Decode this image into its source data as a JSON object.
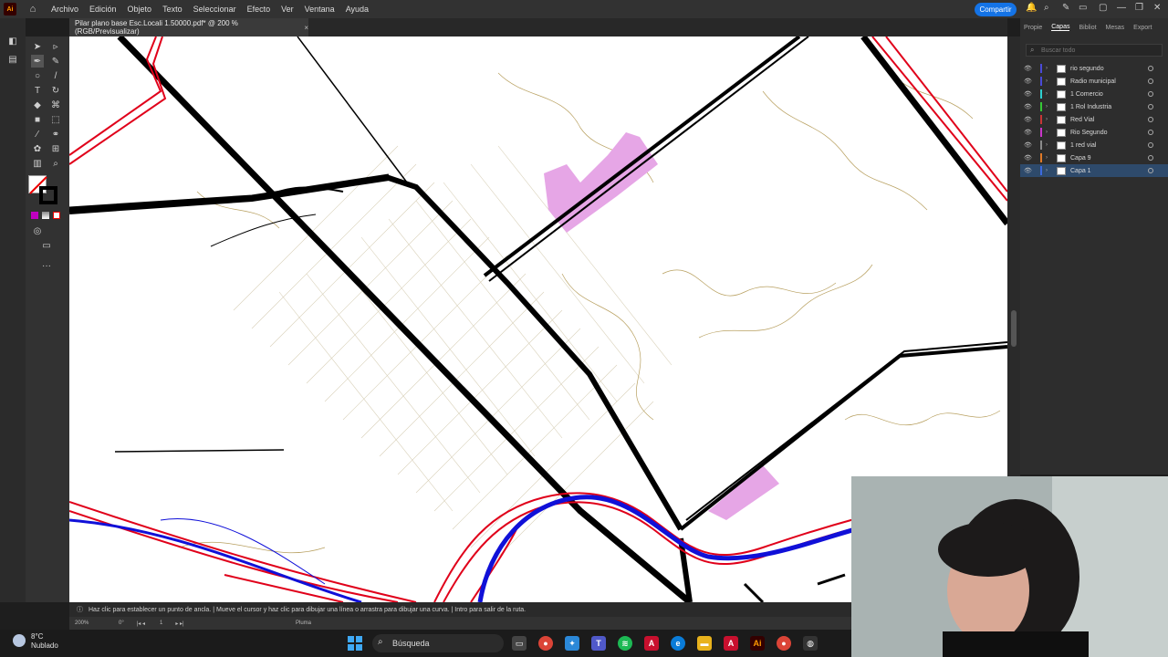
{
  "menubar": {
    "items": [
      "Archivo",
      "Edición",
      "Objeto",
      "Texto",
      "Seleccionar",
      "Efecto",
      "Ver",
      "Ventana",
      "Ayuda"
    ],
    "share_label": "Compartir"
  },
  "document": {
    "tab_title": "Pilar plano base Esc.Locali 1.50000.pdf* @ 200 % (RGB/Previsualizar)"
  },
  "panel": {
    "tabs": [
      "Propie",
      "Capas",
      "Bibliot",
      "Mesas",
      "Export"
    ],
    "active_tab": "Capas",
    "search_placeholder": "Buscar todo",
    "layers": [
      {
        "name": "rio segundo",
        "color": "#4a4ad8"
      },
      {
        "name": "Radio municipal",
        "color": "#4a4ad8"
      },
      {
        "name": "1 Comercio",
        "color": "#2ecfcf"
      },
      {
        "name": "1 Rol Industria",
        "color": "#36c836"
      },
      {
        "name": "Red Vial",
        "color": "#c83636"
      },
      {
        "name": "Rio Segundo",
        "color": "#c836c8"
      },
      {
        "name": "1 red vial",
        "color": "#8a8a8a"
      },
      {
        "name": "Capa 9",
        "color": "#e07a28"
      },
      {
        "name": "Capa 1",
        "color": "#3c6ae0",
        "selected": true
      }
    ]
  },
  "status": {
    "hint": "Haz clic para establecer un punto de ancla. | Mueve el cursor y haz clic para dibujar una línea o arrastra para dibujar una curva. | Intro para salir de la ruta.",
    "zoom": "200%",
    "angle": "0°",
    "artboard": "1",
    "tool": "Pluma"
  },
  "taskbar": {
    "temperature": "8°C",
    "condition": "Nublado",
    "search_label": "Búsqueda"
  }
}
